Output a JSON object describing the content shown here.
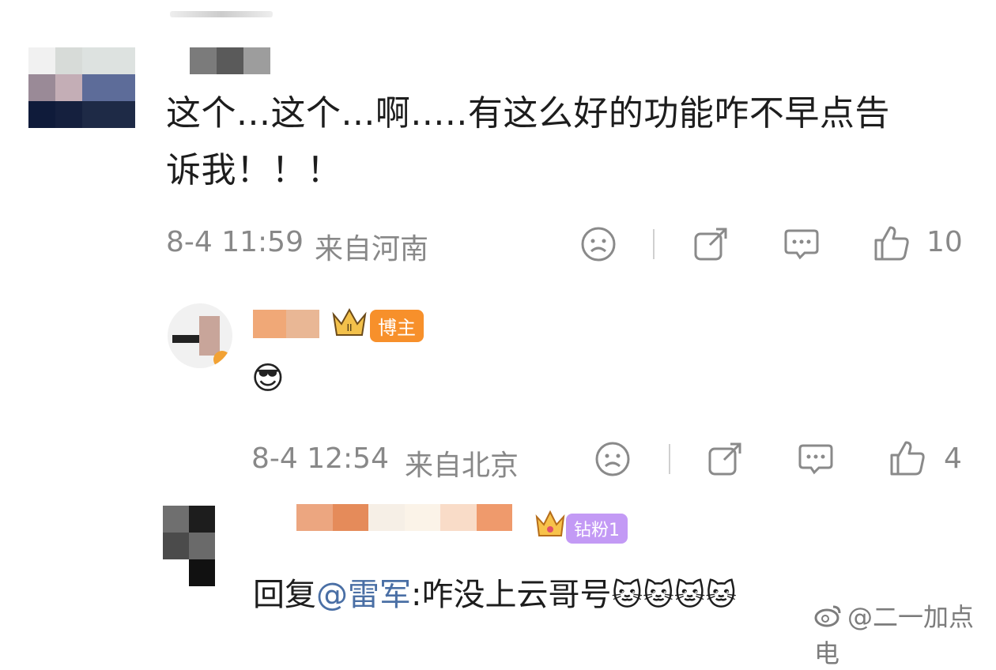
{
  "comment1": {
    "text_line1": "这个...这个...啊.....有这么好的功能咋不早点告",
    "text_line2": "诉我！！！",
    "timestamp": "8-4 11:59",
    "location": "来自河南",
    "like_count": "10"
  },
  "comment2": {
    "author": "雷军",
    "badge": "博主",
    "emoji": "😎",
    "timestamp": "8-4 12:54",
    "location": "来自北京",
    "like_count": "4"
  },
  "comment3": {
    "badge": "钻粉1",
    "reply_prefix": "回复",
    "mention": "@雷军",
    "reply_body": ":咋没上云哥号",
    "emojis": "🐱🐱🐱🐱"
  },
  "watermark": "@二一加点电",
  "icons": {
    "dislike": "sad-face-icon",
    "share": "share-icon",
    "comment": "comment-icon",
    "like": "thumbs-up-icon",
    "crown": "crown-icon",
    "weibo": "weibo-icon"
  },
  "colors": {
    "mention": "#4a6fa5",
    "blogger_badge": "#f7902b",
    "fan_badge": "#c39af5",
    "meta_gray": "#888888"
  }
}
